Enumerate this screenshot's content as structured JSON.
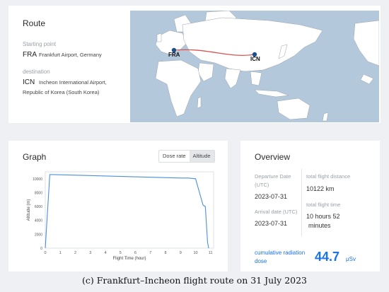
{
  "route": {
    "title": "Route",
    "start_label": "Starting point",
    "start_code": "FRA",
    "start_name": "Frankfurt Airport, Germany",
    "dest_label": "destination",
    "dest_code": "ICN",
    "dest_name_line1": "Incheon International Airport,",
    "dest_name_line2": "Republic of Korea (South Korea)",
    "map": {
      "marker_from": "FRA",
      "marker_to": "ICN",
      "route_color": "#d9534f",
      "marker_color": "#1f4e8c"
    }
  },
  "graph": {
    "title": "Graph",
    "toggle": [
      "Dose rate",
      "Altitude"
    ],
    "active_toggle": "Altitude"
  },
  "chart_data": {
    "type": "line",
    "xlabel": "Flight Time (hour)",
    "ylabel": "Altitude (m)",
    "xlim": [
      0,
      11.2
    ],
    "ylim": [
      0,
      11000
    ],
    "xticks": [
      0,
      1,
      2,
      3,
      4,
      5,
      6,
      7,
      8,
      9,
      10,
      11
    ],
    "yticks": [
      0,
      2000,
      4000,
      6000,
      8000,
      10000
    ],
    "series": [
      {
        "color": "#4a90d9",
        "x": [
          0,
          0.3,
          0.5,
          9,
          9.5,
          10,
          10.5,
          10.65,
          10.8,
          10.87
        ],
        "y": [
          0,
          10600,
          10600,
          10100,
          10100,
          10000,
          6200,
          6000,
          800,
          0
        ]
      }
    ]
  },
  "overview": {
    "title": "Overview",
    "departure_label_1": "Departure Date",
    "departure_label_2": "(UTC)",
    "departure_value": "2023-07-31",
    "distance_label": "total flight distance",
    "distance_value": "10122 km",
    "arrival_label": "Arrival date (UTC)",
    "arrival_value": "2023-07-31",
    "time_label": "total flight time",
    "time_value_1": "10  hours 52",
    "time_value_2": "minutes",
    "dose_label_1": "cumulative radiation",
    "dose_label_2": "dose",
    "dose_value": "44.7",
    "dose_unit": "μSv"
  },
  "caption": "(c) Frankfurt–Incheon flight route on 31 July 2023"
}
